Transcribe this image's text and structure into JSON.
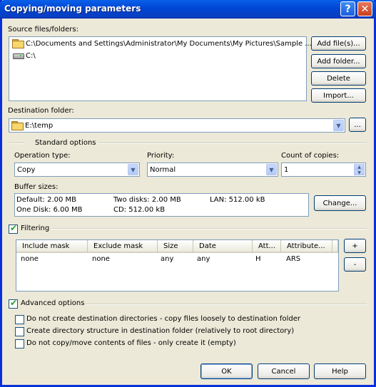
{
  "window": {
    "title": "Copying/moving parameters",
    "help": "?",
    "close": "✕"
  },
  "source": {
    "label": "Source files/folders:",
    "items": [
      {
        "icon": "folder-icon",
        "text": "C:\\Documents and Settings\\Administrator\\My Documents\\My Pictures\\Sample ..."
      },
      {
        "icon": "drive-icon",
        "text": "C:\\"
      }
    ],
    "buttons": {
      "add_files": "Add file(s)...",
      "add_folder": "Add folder...",
      "delete": "Delete",
      "import": "Import..."
    }
  },
  "destination": {
    "label": "Destination folder:",
    "value": "E:\\temp",
    "browse": "..."
  },
  "standard": {
    "title": "Standard options",
    "operation_label": "Operation type:",
    "operation_value": "Copy",
    "priority_label": "Priority:",
    "priority_value": "Normal",
    "copies_label": "Count of copies:",
    "copies_value": "1",
    "buffer_label": "Buffer sizes:",
    "buffers": {
      "default": "Default: 2.00 MB",
      "one_disk": "One Disk: 6.00 MB",
      "two_disks": "Two disks: 2.00 MB",
      "cd": "CD: 512.00 kB",
      "lan": "LAN: 512.00 kB"
    },
    "change": "Change..."
  },
  "filtering": {
    "label": "Filtering",
    "columns": [
      "Include mask",
      "Exclude mask",
      "Size",
      "Date",
      "Att...",
      "Attribute..."
    ],
    "rows": [
      [
        "none",
        "none",
        "any",
        "any",
        "H",
        "ARS"
      ]
    ],
    "add": "+",
    "remove": "-"
  },
  "advanced": {
    "label": "Advanced options",
    "options": [
      "Do not create destination directories - copy files loosely to destination folder",
      "Create directory structure in destination folder (relatively to root directory)",
      "Do not copy/move contents of files - only create it (empty)"
    ]
  },
  "footer": {
    "ok": "OK",
    "cancel": "Cancel",
    "help": "Help"
  }
}
